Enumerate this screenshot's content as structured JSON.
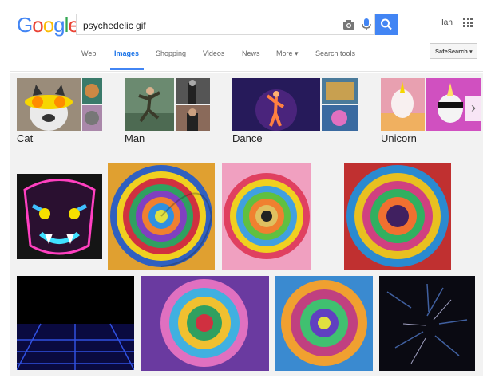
{
  "search": {
    "query": "psychedelic gif"
  },
  "logo": {
    "text": "Google",
    "colors": [
      "#4285f4",
      "#ea4335",
      "#fbbc05",
      "#4285f4",
      "#34a853",
      "#ea4335"
    ]
  },
  "user": {
    "name": "Ian"
  },
  "nav": {
    "tabs": [
      {
        "label": "Web"
      },
      {
        "label": "Images"
      },
      {
        "label": "Shopping"
      },
      {
        "label": "Videos"
      },
      {
        "label": "News"
      },
      {
        "label": "More ▾"
      },
      {
        "label": "Search tools"
      }
    ],
    "active_tab": "Images",
    "safesearch": "SafeSearch ▾"
  },
  "related": [
    {
      "label": "Cat"
    },
    {
      "label": "Man"
    },
    {
      "label": "Dance"
    },
    {
      "label": "Unicorn"
    }
  ],
  "colors": {
    "accent": "#4285f4",
    "background": "#f2f2f2"
  },
  "icons": [
    "camera-icon",
    "microphone-icon",
    "search-icon",
    "apps-grid-icon",
    "chevron-right-icon"
  ]
}
